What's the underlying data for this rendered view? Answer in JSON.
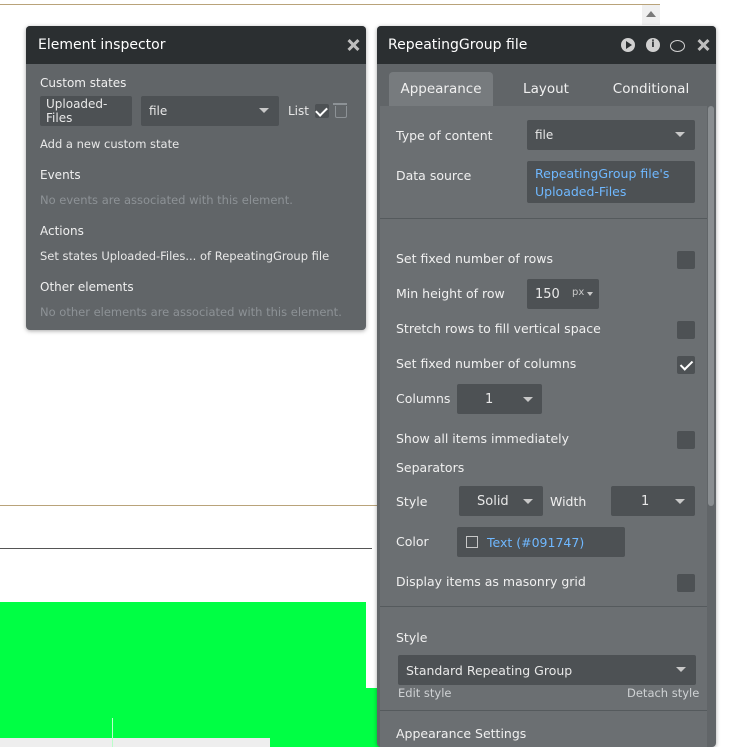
{
  "inspector": {
    "title": "Element inspector",
    "custom_states_label": "Custom states",
    "state_name": "Uploaded-Files",
    "state_type": "file",
    "list_label": "List",
    "add_state": "Add a new custom state",
    "events_label": "Events",
    "events_empty": "No events are associated with this element.",
    "actions_label": "Actions",
    "action_item": "Set states Uploaded-Files... of RepeatingGroup file",
    "other_label": "Other elements",
    "other_empty": "No other elements are associated with this element."
  },
  "editor": {
    "title": "RepeatingGroup file",
    "tabs": [
      "Appearance",
      "Layout",
      "Conditional"
    ],
    "type_of_content_label": "Type of content",
    "type_of_content_value": "file",
    "data_source_label": "Data source",
    "data_source_value": "RepeatingGroup file's Uploaded-Files",
    "fixed_rows_label": "Set fixed number of rows",
    "min_height_label": "Min height of row",
    "min_height_value": "150",
    "min_height_unit": "px",
    "stretch_label": "Stretch rows to fill vertical space",
    "fixed_cols_label": "Set fixed number of columns",
    "columns_label": "Columns",
    "columns_value": "1",
    "show_all_label": "Show all items immediately",
    "separators_label": "Separators",
    "style_label": "Style",
    "style_value": "Solid",
    "width_label": "Width",
    "width_value": "1",
    "color_label": "Color",
    "color_value": "Text (#091747)",
    "masonry_label": "Display items as masonry grid",
    "style_section_label": "Style",
    "style_select_value": "Standard Repeating Group",
    "edit_style": "Edit style",
    "detach_style": "Detach style",
    "appearance_settings": "Appearance Settings"
  },
  "checkbox_states": {
    "list": true,
    "fixed_rows": false,
    "stretch": false,
    "fixed_cols": true,
    "show_all": false,
    "masonry": false
  },
  "colors": {
    "panel_header": "#2b2f31",
    "panel_body": "#616568",
    "link": "#6fb8ff",
    "canvas_green": "#00ff44"
  }
}
